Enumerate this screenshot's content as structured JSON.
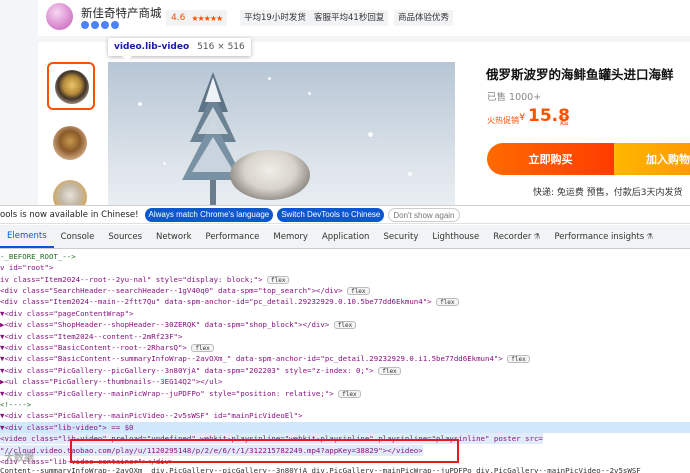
{
  "shop": {
    "name": "新佳奇特产商城",
    "rating": "4.6",
    "stars": "★★★★★",
    "chips": [
      "平均19小时发货",
      "客服平均41秒回复",
      "商品体验优秀"
    ]
  },
  "media": {
    "tooltip_tag": "video.lib-video",
    "tooltip_size": "516 × 516"
  },
  "product": {
    "title": "俄罗斯波罗的海鲱鱼罐头进口海鲜",
    "sold": "已售 1000+",
    "price_label": "火热促销",
    "price_symbol": "¥",
    "price": "15.8",
    "price_unit": "起",
    "buy_button": "立即购买",
    "cart_button": "加入购物",
    "delivery": "快递: 免运费  预售，付款后3天内发货"
  },
  "infobar": {
    "message": "ools is now available in Chinese!",
    "match_button": "Always match Chrome's language",
    "switch_button": "Switch DevTools to Chinese",
    "dismiss_button": "Don't show again"
  },
  "devtools": {
    "tabs": [
      "Elements",
      "Console",
      "Sources",
      "Network",
      "Performance",
      "Memory",
      "Application",
      "Security",
      "Lighthouse",
      "Recorder",
      "Performance insights"
    ],
    "active_tab": "Elements",
    "lines": [
      "-_BEFORE_ROOT_-->",
      "v id=\"root\">",
      "iv class=\"Item2024--root--2yu-nal\" style=\"display: block;\">",
      "<div class=\"SearchHeader--searchHeader--1gV40q0\" data-spm=\"top_search\"></div>",
      "<div class=\"Item2024--main--2ftt7Qu\" data-spm-anchor-id=\"pc_detail.29232929.0.10.5be77dd6Ekmun4\">",
      "▼<div class=\"pageContentWrap\">",
      "  ▶<div class=\"ShopHeader--shopHeader--30ZERQK\" data-spm=\"shop_block\"></div>",
      "  ▼<div class=\"Item2024--content--2mRf23F\">",
      "    ▼<div class=\"BasicContent--root--2RharsQ\">",
      "      ▼<div class=\"BasicContent--summaryInfoWrap--2avOXm_\" data-spm-anchor-id=\"pc_detail.29232929.0.i1.5be77dd6Ekmun4\">",
      "        ▼<div class=\"PicGallery--picGallery--3n80YjA\" data-spm=\"202203\" style=\"z-index: 0;\">",
      "          ▶<ul class=\"PicGallery--thumbnails--3EG14Q2\"></ul>",
      "          ▼<div class=\"PicGallery--mainPicWrap--juPDFPo\" style=\"position: relative;\">",
      "              <!---->",
      "            ▼<div class=\"PicGallery--mainPicVideo--2v5sWSF\" id=\"mainPicVideoEl\">",
      "              ▼<div class=\"lib-video\"> == $0",
      "                  <video class=\"lib-video\" preload=\"undefined\" webkit-playsinline=\"webkit-playsinline\" playsinline=\"playsinline\" poster src=",
      "                  \"//cloud.video.taobao.com/play/u/1120295148/p/2/e/6/t/1/312215782249.mp4?appKey=38829\"></video>",
      "                  <div class=\"lib-video-container\"></div>",
      "Content--summaryInfoWrap--2avOXm_ div.PicGallery--picGallery--3n80YjA div.PicGallery--mainPicWrap--juPDFPo div.PicGallery--mainPicVideo--2v5sWSF"
    ],
    "badge": "flex",
    "watermark": "大数据"
  }
}
